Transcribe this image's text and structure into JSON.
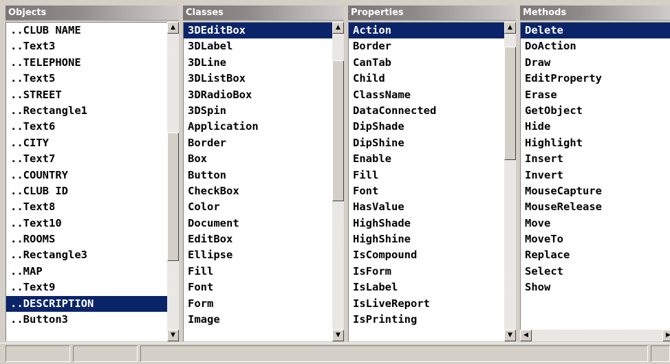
{
  "panes": {
    "objects": {
      "header": "Objects",
      "items": [
        "..CLUB NAME",
        "..Text3",
        "..TELEPHONE",
        "..Text5",
        "..STREET",
        "..Rectangle1",
        "..Text6",
        "..CITY",
        "..Text7",
        "..COUNTRY",
        "..CLUB ID",
        "..Text8",
        "..Text10",
        "..ROOMS",
        "..Rectangle3",
        "..MAP",
        "..Text9",
        "..DESCRIPTION",
        "..Button3"
      ],
      "selected_index": 17
    },
    "classes": {
      "header": "Classes",
      "items": [
        "3DEditBox",
        "3DLabel",
        "3DLine",
        "3DListBox",
        "3DRadioBox",
        "3DSpin",
        "Application",
        "Border",
        "Box",
        "Button",
        "CheckBox",
        "Color",
        "Document",
        "EditBox",
        "Ellipse",
        "Fill",
        "Font",
        "Form",
        "Image"
      ],
      "selected_index": 0
    },
    "properties": {
      "header": "Properties",
      "items": [
        "Action",
        "Border",
        "CanTab",
        "Child",
        "ClassName",
        "DataConnected",
        "DipShade",
        "DipShine",
        "Enable",
        "Fill",
        "Font",
        "HasValue",
        "HighShade",
        "HighShine",
        "IsCompound",
        "IsForm",
        "IsLabel",
        "IsLiveReport",
        "IsPrinting"
      ],
      "selected_index": 0
    },
    "methods": {
      "header": "Methods",
      "items": [
        "Delete",
        "DoAction",
        "Draw",
        "EditProperty",
        "Erase",
        "GetObject",
        "Hide",
        "Highlight",
        "Insert",
        "Invert",
        "MouseCapture",
        "MouseRelease",
        "Move",
        "MoveTo",
        "Replace",
        "Select",
        "Show"
      ],
      "selected_index": 0
    }
  },
  "icons": {
    "scroll_up": "▲",
    "scroll_down": "▼",
    "scroll_left": "◀",
    "scroll_right": "▶"
  },
  "colors": {
    "selection": "#0a246a",
    "chrome": "#d4d0c8"
  }
}
